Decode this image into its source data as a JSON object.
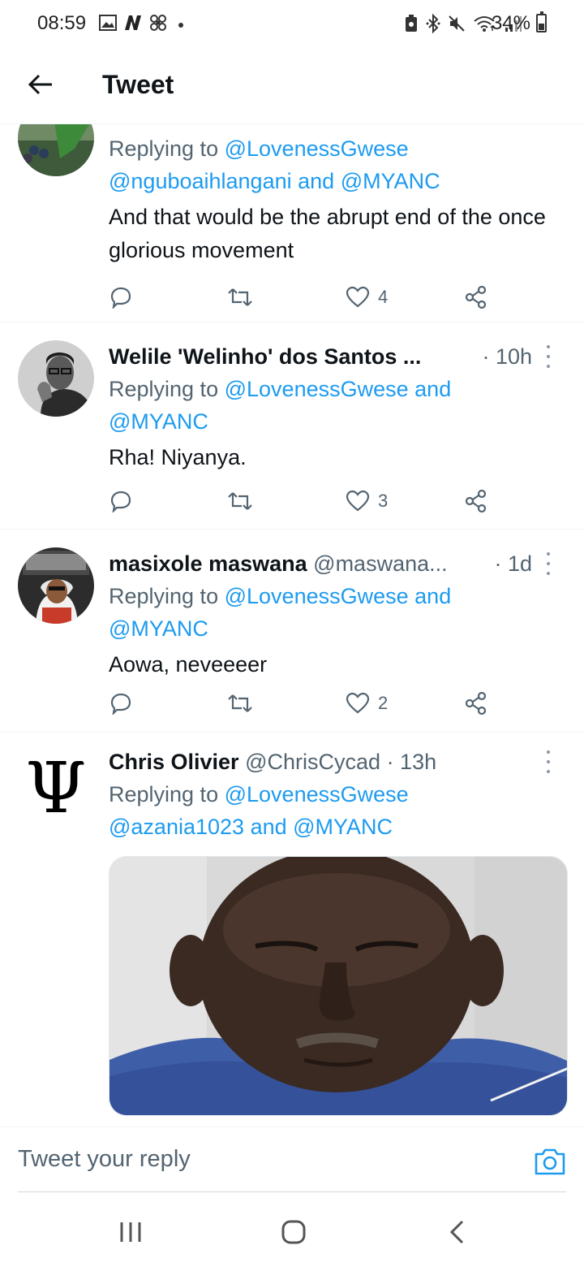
{
  "status_bar": {
    "time": "08:59",
    "battery": "34%",
    "left_icons": [
      "gallery-icon",
      "n-app-icon",
      "fan-icon",
      "dot-icon"
    ],
    "right_icons": [
      "lock-battery-icon",
      "bluetooth-icon",
      "mute-icon",
      "wifi-icon",
      "signal-icon",
      "battery-icon"
    ]
  },
  "header": {
    "title": "Tweet"
  },
  "tweets": [
    {
      "replying_label": "Replying to",
      "mentions": [
        "@LovenessGwese",
        "@nguboaihlangani",
        "@MYANC"
      ],
      "and_label": "and",
      "text": "And that would be the abrupt end of the once glorious movement",
      "likes": "4"
    },
    {
      "name": "Welile 'Welinho' dos Santos ...",
      "time": "· 10h",
      "replying_label": "Replying to",
      "mentions": [
        "@LovenessGwese",
        "@MYANC"
      ],
      "and_label": "and",
      "text": "Rha! Niyanya.",
      "likes": "3"
    },
    {
      "name": "masixole maswana",
      "handle": "@maswana...",
      "time": "· 1d",
      "replying_label": "Replying to",
      "mentions": [
        "@LovenessGwese",
        "@MYANC"
      ],
      "and_label": "and",
      "text": "Aowa, neveeeer",
      "likes": "2"
    },
    {
      "name": "Chris Olivier",
      "handle": "@ChrisCycad",
      "time": "· 13h",
      "avatar_glyph": "Ψ",
      "replying_label": "Replying to",
      "mentions": [
        "@LovenessGwese",
        "@azania1023",
        "@MYANC"
      ],
      "and_label": "and"
    }
  ],
  "reply_bar": {
    "placeholder": "Tweet your reply"
  },
  "colors": {
    "accent": "#1d9bf0",
    "text": "#0f1419",
    "secondary": "#536471"
  }
}
